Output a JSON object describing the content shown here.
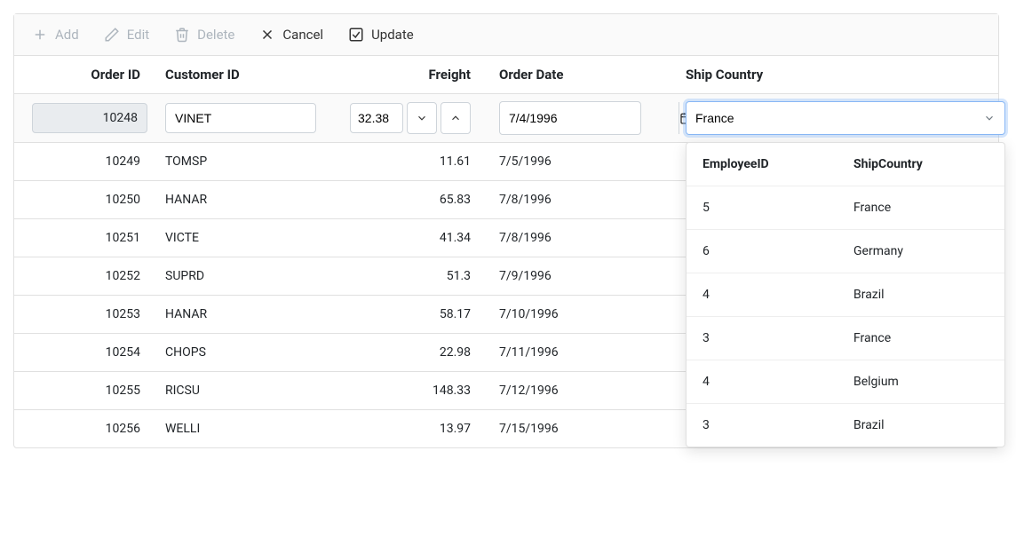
{
  "toolbar": {
    "add_label": "Add",
    "edit_label": "Edit",
    "delete_label": "Delete",
    "cancel_label": "Cancel",
    "update_label": "Update"
  },
  "columns": {
    "order_id": "Order ID",
    "customer_id": "Customer ID",
    "freight": "Freight",
    "order_date": "Order Date",
    "ship_country": "Ship Country"
  },
  "edit_row": {
    "order_id": "10248",
    "customer_id": "VINET",
    "freight": "32.38",
    "order_date": "7/4/1996",
    "ship_country": "France"
  },
  "dropdown": {
    "columns": {
      "employee_id": "EmployeeID",
      "ship_country": "ShipCountry"
    },
    "options": [
      {
        "emp": "5",
        "country": "France"
      },
      {
        "emp": "6",
        "country": "Germany"
      },
      {
        "emp": "4",
        "country": "Brazil"
      },
      {
        "emp": "3",
        "country": "France"
      },
      {
        "emp": "4",
        "country": "Belgium"
      },
      {
        "emp": "3",
        "country": "Brazil"
      }
    ]
  },
  "rows": [
    {
      "order_id": "10249",
      "customer_id": "TOMSP",
      "freight": "11.61",
      "order_date": "7/5/1996"
    },
    {
      "order_id": "10250",
      "customer_id": "HANAR",
      "freight": "65.83",
      "order_date": "7/8/1996"
    },
    {
      "order_id": "10251",
      "customer_id": "VICTE",
      "freight": "41.34",
      "order_date": "7/8/1996"
    },
    {
      "order_id": "10252",
      "customer_id": "SUPRD",
      "freight": "51.3",
      "order_date": "7/9/1996"
    },
    {
      "order_id": "10253",
      "customer_id": "HANAR",
      "freight": "58.17",
      "order_date": "7/10/1996"
    },
    {
      "order_id": "10254",
      "customer_id": "CHOPS",
      "freight": "22.98",
      "order_date": "7/11/1996"
    },
    {
      "order_id": "10255",
      "customer_id": "RICSU",
      "freight": "148.33",
      "order_date": "7/12/1996"
    },
    {
      "order_id": "10256",
      "customer_id": "WELLI",
      "freight": "13.97",
      "order_date": "7/15/1996"
    }
  ]
}
